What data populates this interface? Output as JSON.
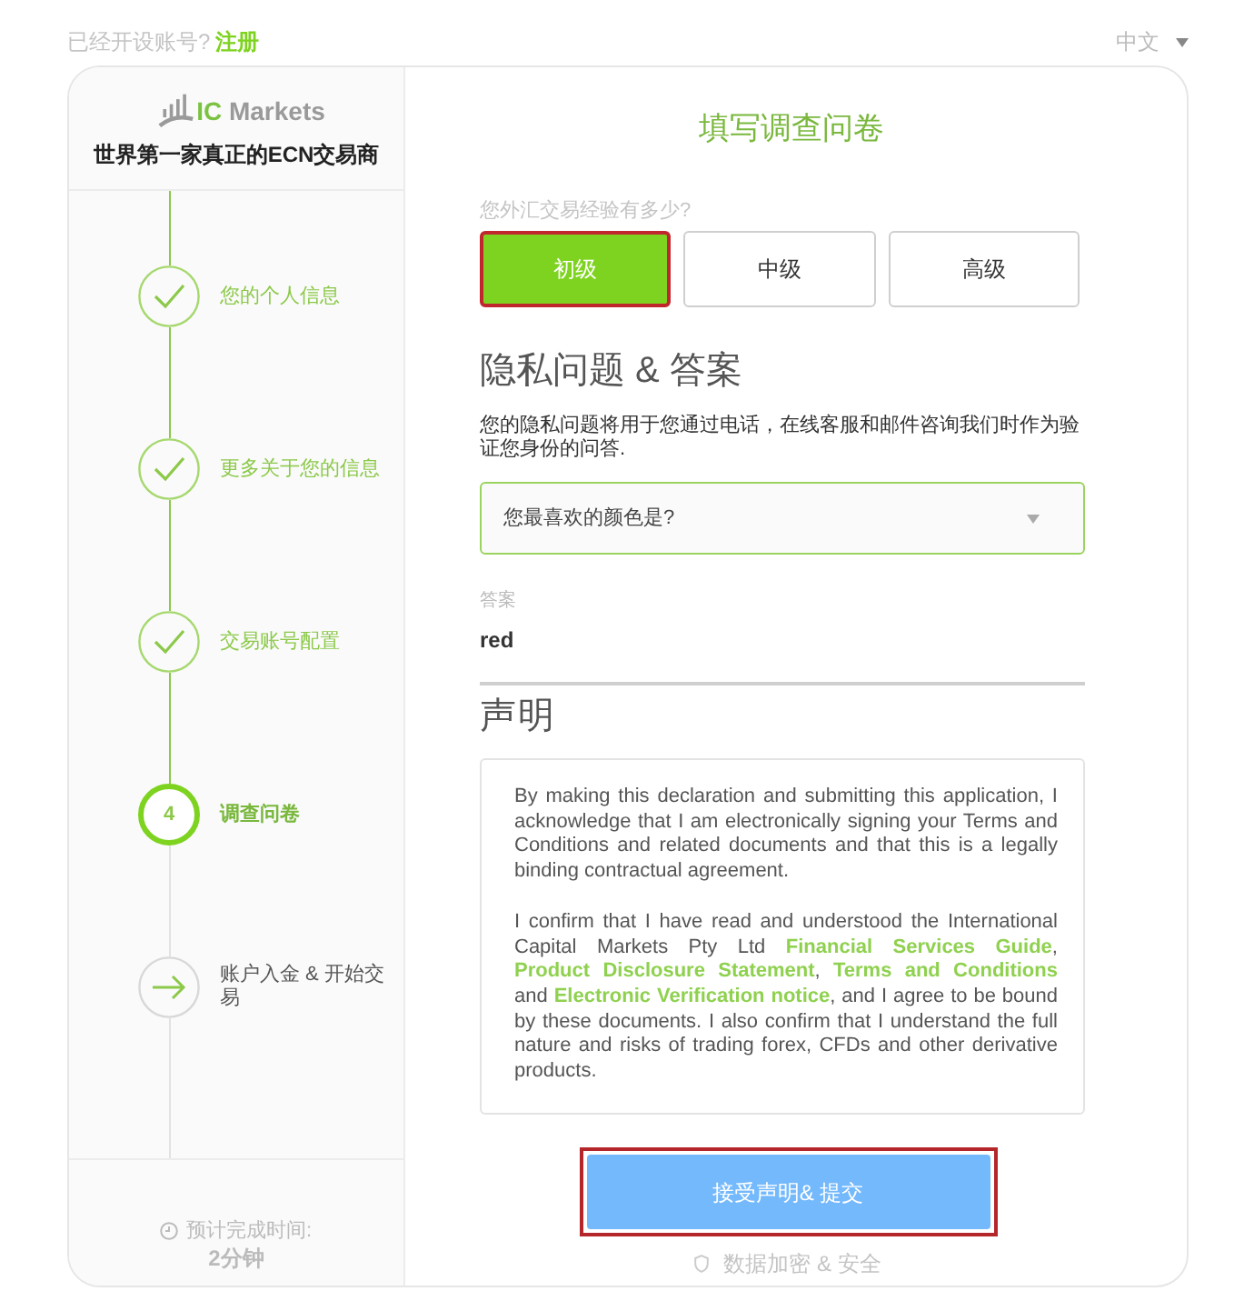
{
  "top_bar": {
    "prompt": "已经开设账号?",
    "link": "注册",
    "language": "中文"
  },
  "sidebar": {
    "logo": {
      "mark": "IC",
      "name": "Markets"
    },
    "tagline": "世界第一家真正的ECN交易商",
    "steps": [
      {
        "label": "您的个人信息",
        "completed": true,
        "current": false
      },
      {
        "label": "更多关于您的信息",
        "completed": true,
        "current": false
      },
      {
        "label": "交易账号配置",
        "completed": true,
        "current": false
      },
      {
        "label": "调查问卷",
        "completed": false,
        "current": true,
        "number": "4"
      },
      {
        "label": "账户入金 & 开始交易",
        "completed": false,
        "current": false
      }
    ],
    "estimate": {
      "label": "预计完成时间:",
      "value": "2分钟"
    }
  },
  "form": {
    "title": "填写调查问卷",
    "experience": {
      "question": "您外汇交易经验有多少?",
      "options": [
        {
          "label": "初级",
          "selected": true,
          "highlighted": true
        },
        {
          "label": "中级",
          "selected": false,
          "highlighted": false
        },
        {
          "label": "高级",
          "selected": false,
          "highlighted": false
        }
      ]
    },
    "privacy": {
      "heading": "隐私问题 & 答案",
      "description": "您的隐私问题将用于您通过电话，在线客服和邮件咨询我们时作为验证您身份的问答.",
      "question_select": {
        "value": "您最喜欢的颜色是?"
      },
      "answer": {
        "label": "答案",
        "value": "red"
      }
    },
    "declaration": {
      "heading": "声明",
      "paragraphs": [
        [
          {
            "kind": "text",
            "text": "By making this declaration and submitting this application, I acknowledge that I am electronically signing your Terms and Conditions and related documents and that this is a legally binding contractual agreement."
          }
        ],
        [
          {
            "kind": "text",
            "text": "I confirm that I have read and understood the International Capital Markets Pty Ltd "
          },
          {
            "kind": "link",
            "text": "Financial Services Guide"
          },
          {
            "kind": "text",
            "text": ", "
          },
          {
            "kind": "link",
            "text": "Product Disclosure Statement"
          },
          {
            "kind": "text",
            "text": ", "
          },
          {
            "kind": "link",
            "text": "Terms and Conditions"
          },
          {
            "kind": "text",
            "text": " and "
          },
          {
            "kind": "link",
            "text": "Electronic Verification notice"
          },
          {
            "kind": "text",
            "text": ", and I agree to be bound by these documents. I also confirm that I understand the full nature and risks of trading forex, CFDs and other derivative products."
          }
        ]
      ]
    },
    "submit": {
      "label": "接受声明& 提交",
      "highlighted": true
    },
    "security_note": "数据加密 & 安全"
  }
}
